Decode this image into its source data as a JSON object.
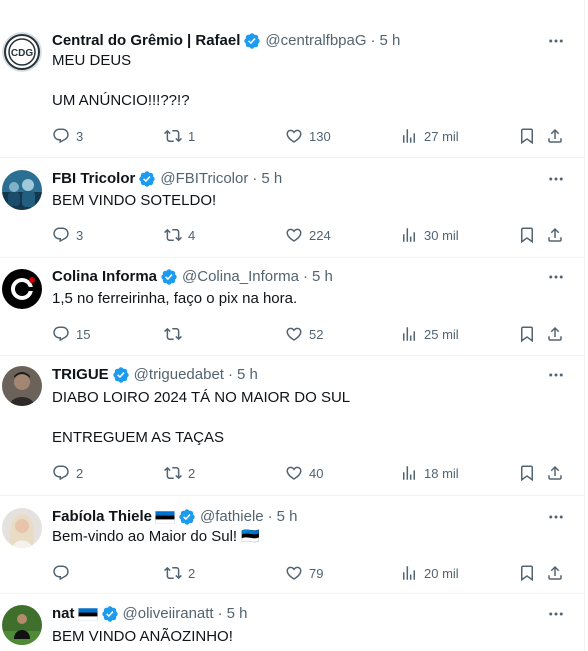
{
  "tweets": [
    {
      "name": "Central do Grêmio | Rafael",
      "verified": true,
      "flag": false,
      "handle": "@centralfbpaG",
      "time": "5 h",
      "text": "MEU DEUS\n\nUM ANÚNCIO!!!??!?",
      "replies": "3",
      "retweets": "1",
      "likes": "130",
      "views": "27 mil",
      "avatar": "gremio-logo"
    },
    {
      "name": "FBI Tricolor",
      "verified": true,
      "flag": false,
      "handle": "@FBITricolor",
      "time": "5 h",
      "text": "BEM VINDO SOTELDO!",
      "replies": "3",
      "retweets": "4",
      "likes": "224",
      "views": "30 mil",
      "avatar": "team-photo"
    },
    {
      "name": "Colina Informa",
      "verified": true,
      "flag": false,
      "handle": "@Colina_Informa",
      "time": "5 h",
      "text": "1,5 no ferreirinha, faço o pix na hora.",
      "replies": "15",
      "retweets": "",
      "likes": "52",
      "views": "25 mil",
      "avatar": "colina-logo"
    },
    {
      "name": "TRIGUE",
      "verified": true,
      "flag": false,
      "handle": "@triguedabet",
      "time": "5 h",
      "text": "DIABO LOIRO 2024 TÁ NO MAIOR DO SUL\n\nENTREGUEM AS TAÇAS",
      "replies": "2",
      "retweets": "2",
      "likes": "40",
      "views": "18 mil",
      "avatar": "person-photo"
    },
    {
      "name": "Fabíola Thiele",
      "verified": true,
      "flag": true,
      "handle": "@fathiele",
      "time": "5 h",
      "text": "Bem-vindo ao Maior do Sul! 🇪🇪",
      "replies": "",
      "retweets": "2",
      "likes": "79",
      "views": "20 mil",
      "avatar": "woman-photo"
    },
    {
      "name": "nat",
      "verified": true,
      "flag": true,
      "handle": "@oliveiiranatt",
      "time": "5 h",
      "text": "BEM VINDO ANÃOZINHO!",
      "replies": "",
      "retweets": "",
      "likes": "",
      "views": "",
      "avatar": "soccer-photo"
    }
  ],
  "colors": {
    "verified": "#1d9bf0",
    "muted": "#536471",
    "text": "#0f1419",
    "divider": "#eff3f4",
    "flag_blue": "#0072ce",
    "flag_black": "#000000"
  }
}
